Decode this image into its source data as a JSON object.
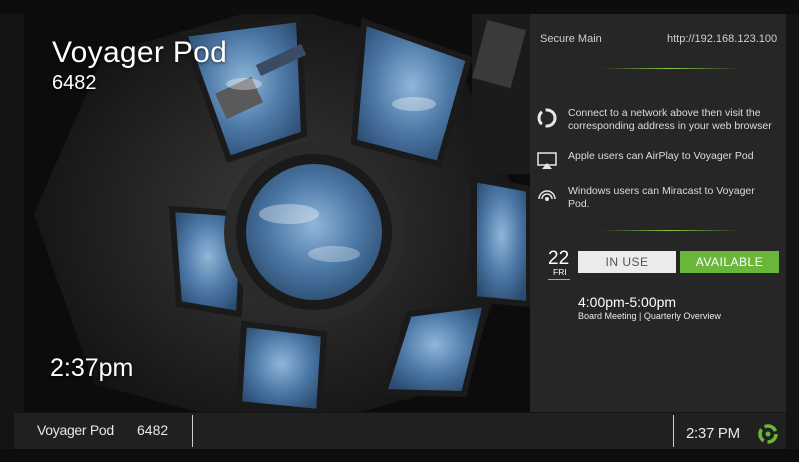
{
  "room": {
    "name": "Voyager Pod",
    "number": "6482",
    "time_large": "2:37pm"
  },
  "network": {
    "name": "Secure Main",
    "url": "http://192.168.123.100"
  },
  "instructions": [
    {
      "icon": "connect-logo-icon",
      "text": "Connect to a network above then visit the corresponding address in your web browser"
    },
    {
      "icon": "airplay-icon",
      "text": "Apple users can AirPlay to Voyager Pod"
    },
    {
      "icon": "miracast-icon",
      "text": "Windows users can Miracast to Voyager Pod."
    }
  ],
  "date": {
    "day_number": "22",
    "day_name": "FRI"
  },
  "status": {
    "in_use_label": "IN USE",
    "available_label": "AVAILABLE"
  },
  "meeting": {
    "time": "4:00pm-5:00pm",
    "title": "Board Meeting | Quarterly Overview"
  },
  "footer": {
    "room_name": "Voyager Pod",
    "room_number": "6482",
    "clock": "2:37 PM"
  },
  "colors": {
    "accent_green": "#6ab63a",
    "panel_bg": "#262626",
    "footer_bg": "#202020"
  }
}
